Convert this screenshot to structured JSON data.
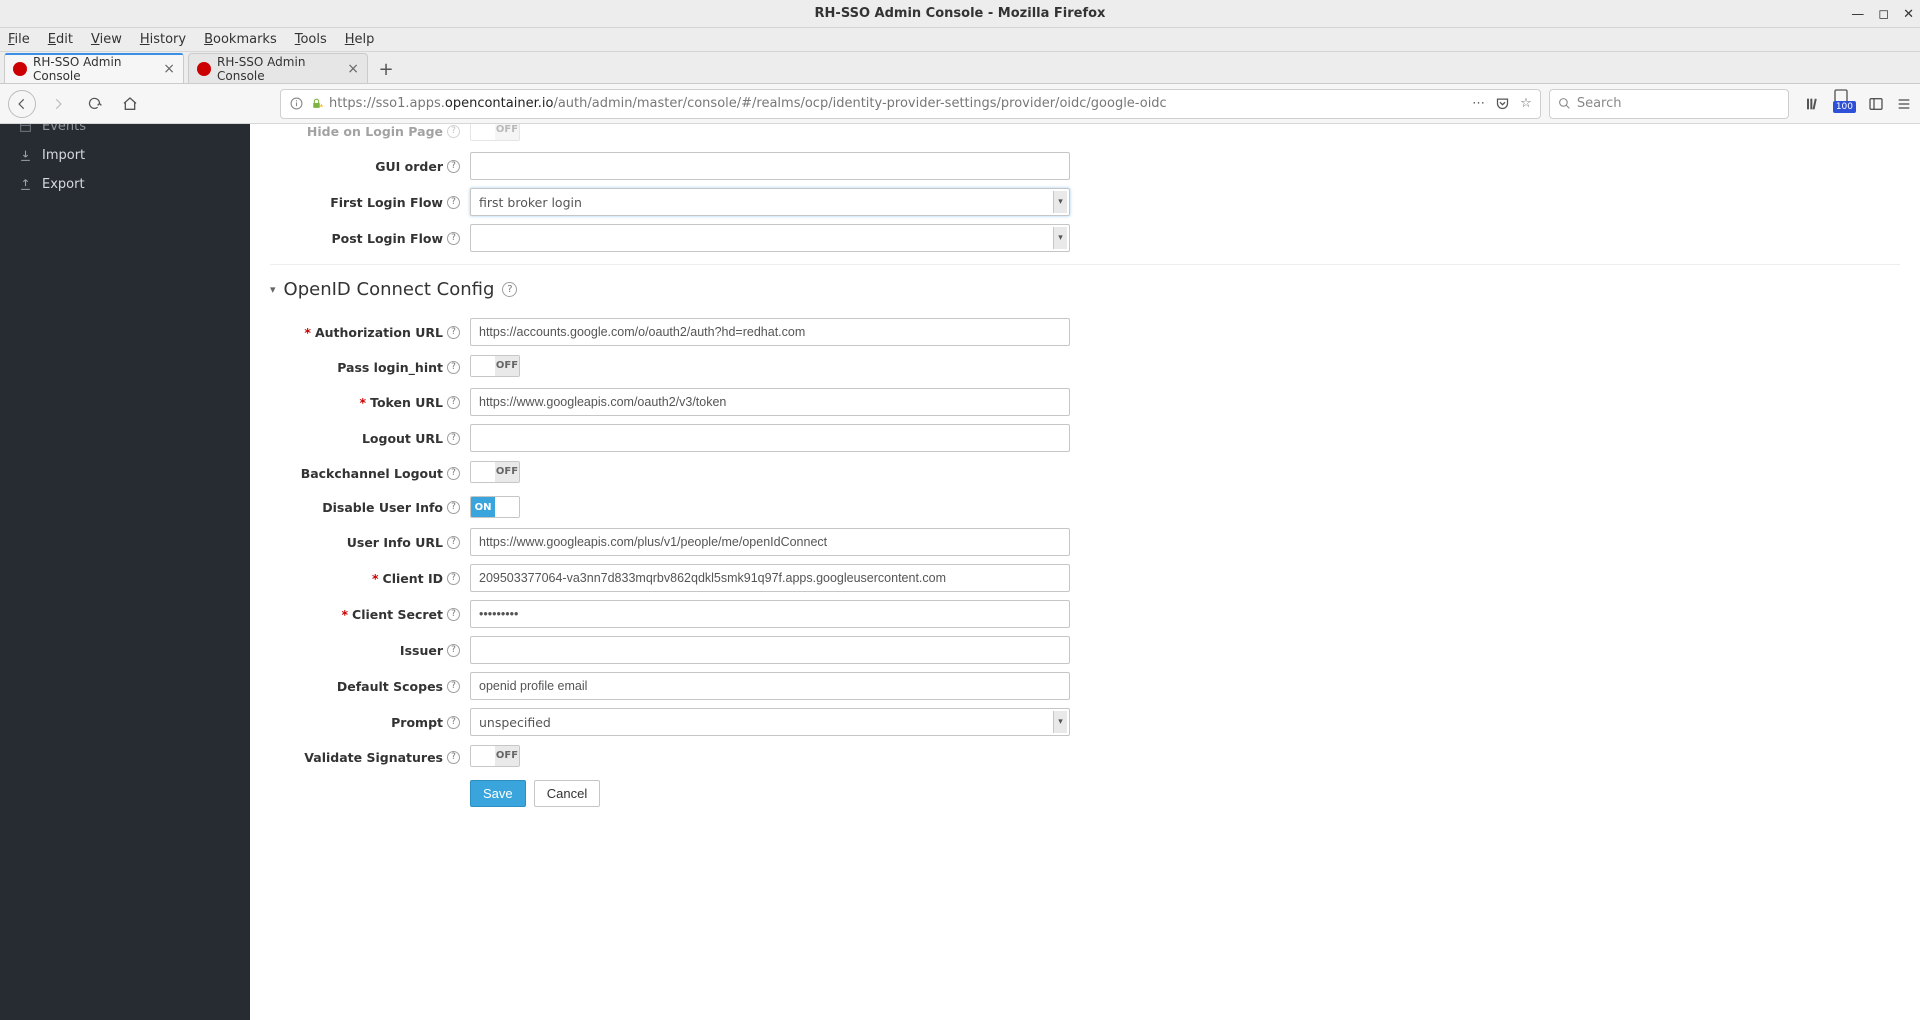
{
  "window": {
    "title": "RH-SSO Admin Console - Mozilla Firefox"
  },
  "menubar": [
    "File",
    "Edit",
    "View",
    "History",
    "Bookmarks",
    "Tools",
    "Help"
  ],
  "tabs": [
    {
      "label": "RH-SSO Admin Console",
      "active": true
    },
    {
      "label": "RH-SSO Admin Console",
      "active": false
    }
  ],
  "url": {
    "info_prefix": "https://sso1.apps.",
    "host": "opencontainer.io",
    "path": "/auth/admin/master/console/#/realms/ocp/identity-provider-settings/provider/oidc/google-oidc"
  },
  "search": {
    "placeholder": "Search"
  },
  "toolbar_badge": "100",
  "sidebar": {
    "items": [
      {
        "icon": "events-icon",
        "label": "Events"
      },
      {
        "icon": "import-icon",
        "label": "Import"
      },
      {
        "icon": "export-icon",
        "label": "Export"
      }
    ]
  },
  "form": {
    "hide_on_login_label": "Hide on Login Page",
    "hide_on_login_value": "OFF",
    "gui_order_label": "GUI order",
    "gui_order_value": "",
    "first_login_flow_label": "First Login Flow",
    "first_login_flow_value": "first broker login",
    "post_login_flow_label": "Post Login Flow",
    "post_login_flow_value": "",
    "section_oidc": "OpenID Connect Config",
    "authorization_url_label": "Authorization URL",
    "authorization_url_value": "https://accounts.google.com/o/oauth2/auth?hd=redhat.com",
    "pass_login_hint_label": "Pass login_hint",
    "pass_login_hint_value": "OFF",
    "token_url_label": "Token URL",
    "token_url_value": "https://www.googleapis.com/oauth2/v3/token",
    "logout_url_label": "Logout URL",
    "logout_url_value": "",
    "backchannel_logout_label": "Backchannel Logout",
    "backchannel_logout_value": "OFF",
    "disable_user_info_label": "Disable User Info",
    "disable_user_info_value": "ON",
    "user_info_url_label": "User Info URL",
    "user_info_url_value": "https://www.googleapis.com/plus/v1/people/me/openIdConnect",
    "client_id_label": "Client ID",
    "client_id_value": "209503377064-va3nn7d833mqrbv862qdkl5smk91q97f.apps.googleusercontent.com",
    "client_secret_label": "Client Secret",
    "client_secret_value": "•••••••••",
    "issuer_label": "Issuer",
    "issuer_value": "",
    "default_scopes_label": "Default Scopes",
    "default_scopes_value": "openid profile email",
    "prompt_label": "Prompt",
    "prompt_value": "unspecified",
    "validate_signatures_label": "Validate Signatures",
    "validate_signatures_value": "OFF",
    "save_label": "Save",
    "cancel_label": "Cancel",
    "on_text": "ON",
    "off_text": "OFF"
  }
}
